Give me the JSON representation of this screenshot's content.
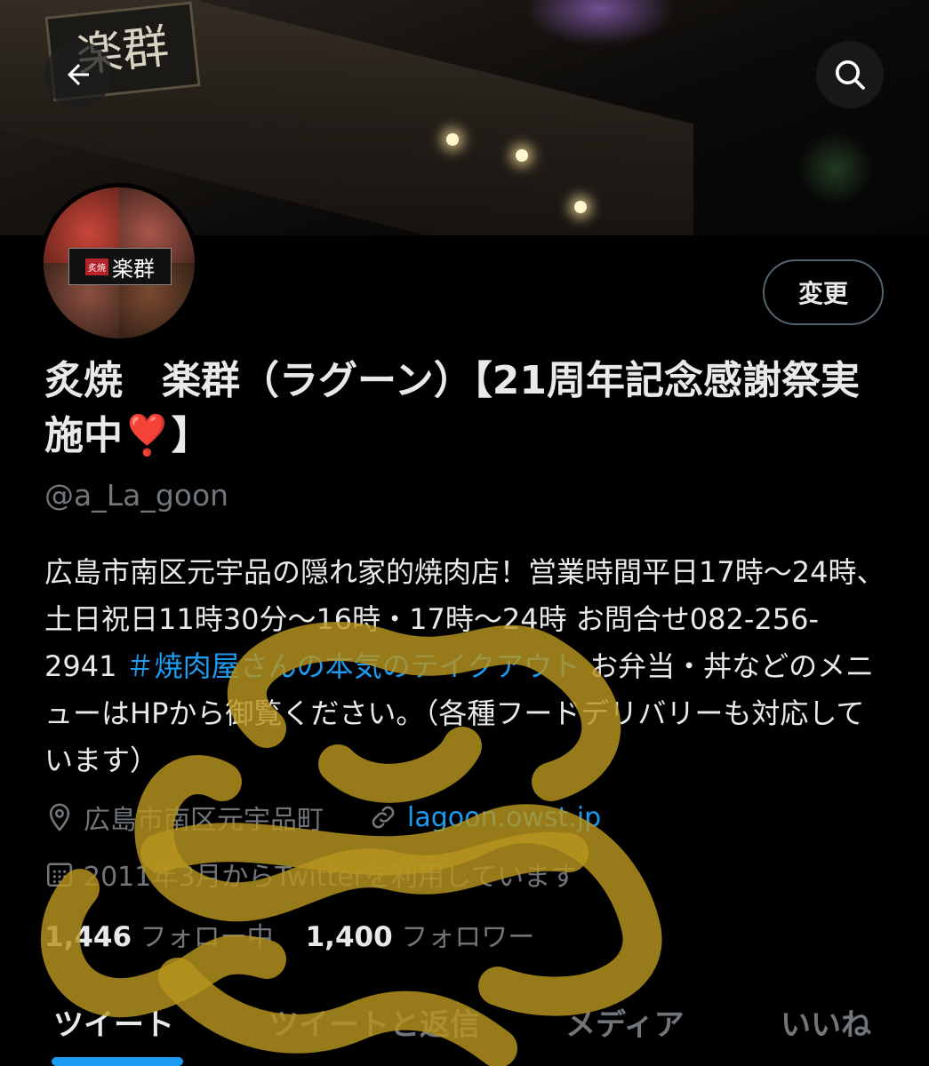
{
  "header": {
    "signboard_text": "楽群",
    "back_icon": "arrow-left-icon",
    "search_icon": "search-icon"
  },
  "avatar": {
    "logo_mark": "炙焼",
    "logo_text": "楽群"
  },
  "edit_button_label": "変更",
  "profile": {
    "name": "炙焼　楽群（ラグーン）【21周年記念感謝祭実施中❣️】",
    "handle": "@a_La_goon",
    "bio_text": "広島市南区元宇品の隠れ家的焼肉店！営業時間平日17時〜24時、土日祝日11時30分〜16時・17時〜24時 お問合せ082-256-2941 ",
    "bio_hashtag": "＃焼肉屋さんの本気のテイクアウト",
    "bio_text_2": " お弁当・丼などのメニューはHPから御覧ください。（各種フードデリバリーも対応しています）",
    "location": "広島市南区元宇品町",
    "website": "lagoon.owst.jp",
    "joined": "2011年3月からTwitterを利用しています"
  },
  "stats": {
    "following_count": "1,446",
    "following_label": "フォロー中",
    "followers_count": "1,400",
    "followers_label": "フォロワー"
  },
  "tabs": {
    "tweets": "ツイート",
    "replies": "ツイートと返信",
    "media": "メディア",
    "likes": "いいね"
  },
  "colors": {
    "accent": "#1d9bf0",
    "muted": "#71767b",
    "text": "#e7e9ea",
    "scribble": "#c9a227"
  }
}
